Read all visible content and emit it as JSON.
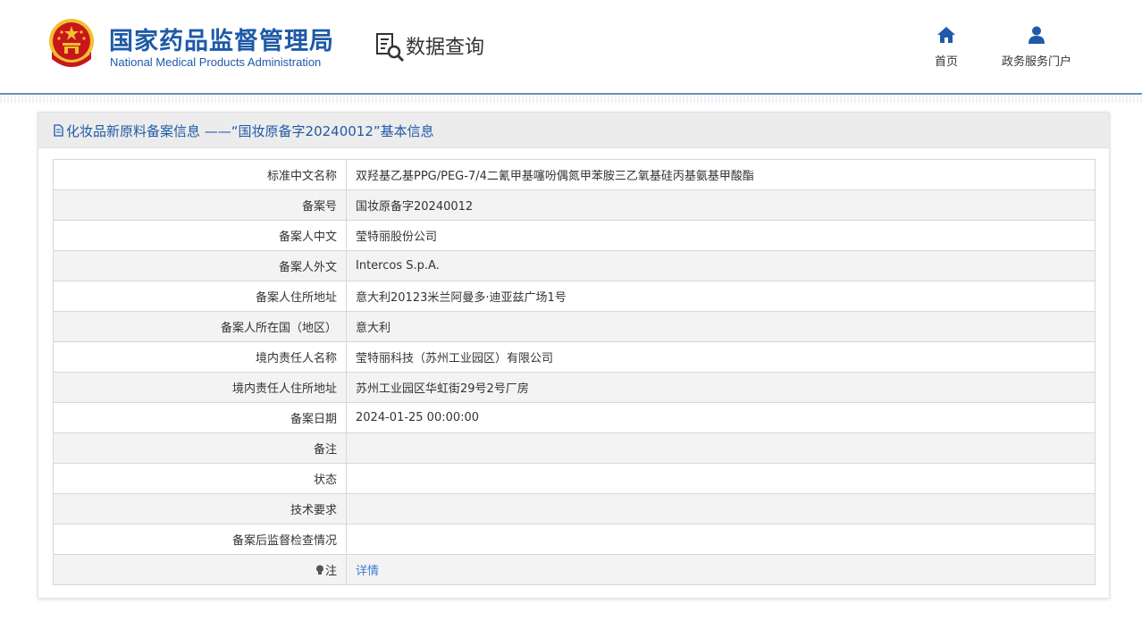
{
  "header": {
    "org_name_cn": "国家药品监督管理局",
    "org_name_en": "National Medical Products Administration",
    "section_title": "数据查询",
    "nav": [
      {
        "label": "首页",
        "icon": "home-icon"
      },
      {
        "label": "政务服务门户",
        "icon": "user-icon"
      }
    ]
  },
  "panel": {
    "title": "化妆品新原料备案信息 ——“国妆原备字20240012”基本信息"
  },
  "rows": [
    {
      "key": "标准中文名称",
      "value": "双羟基乙基PPG/PEG-7/4二氰甲基噻吩偶氮甲苯胺三乙氧基硅丙基氨基甲酸酯"
    },
    {
      "key": "备案号",
      "value": "国妆原备字20240012"
    },
    {
      "key": "备案人中文",
      "value": "莹特丽股份公司"
    },
    {
      "key": "备案人外文",
      "value": "Intercos S.p.A."
    },
    {
      "key": "备案人住所地址",
      "value": "意大利20123米兰阿曼多·迪亚兹广场1号"
    },
    {
      "key": "备案人所在国（地区）",
      "value": "意大利"
    },
    {
      "key": "境内责任人名称",
      "value": "莹特丽科技（苏州工业园区）有限公司"
    },
    {
      "key": "境内责任人住所地址",
      "value": "苏州工业园区华虹街29号2号厂房"
    },
    {
      "key": "备案日期",
      "value": "2024-01-25 00:00:00"
    },
    {
      "key": "备注",
      "value": ""
    },
    {
      "key": "状态",
      "value": ""
    },
    {
      "key": "技术要求",
      "value": ""
    },
    {
      "key": "备案后监督检查情况",
      "value": ""
    },
    {
      "key": "注",
      "value": "详情",
      "icon": "lightbulb-icon"
    }
  ],
  "colors": {
    "brand_blue": "#1e5aa8",
    "link_blue": "#3a7fd5",
    "emblem_red": "#c8161d",
    "emblem_gold": "#f2c12e"
  }
}
